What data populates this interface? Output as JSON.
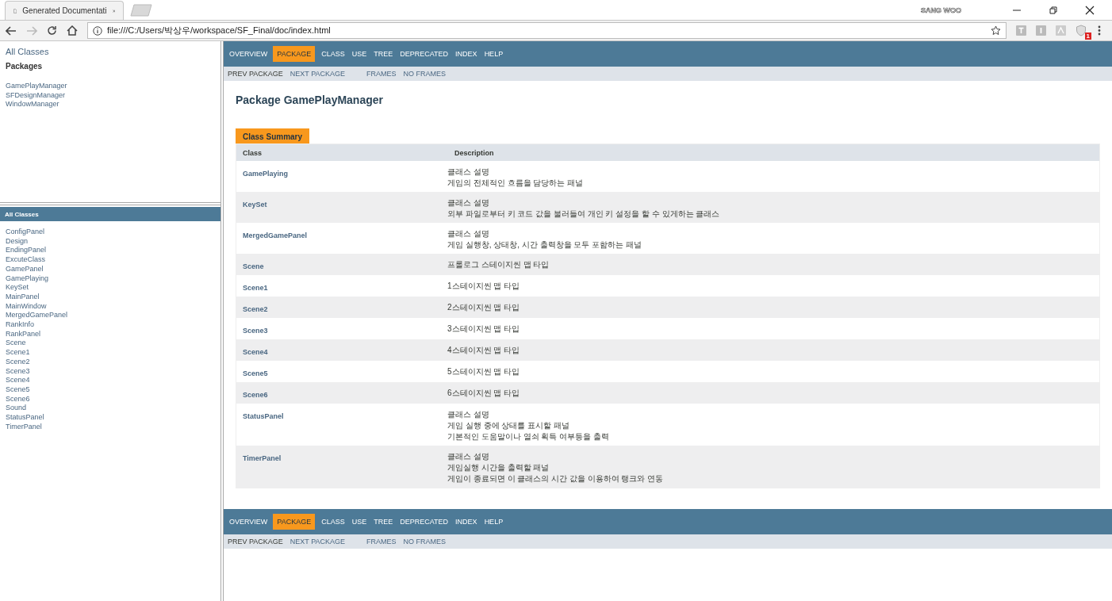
{
  "browser": {
    "tab_title": "Generated Documentati",
    "user": "SANG WOO",
    "url": "file:///C:/Users/박상우/workspace/SF_Final/doc/index.html",
    "extension_badge": "1"
  },
  "packages_frame": {
    "all_classes_link": "All Classes",
    "heading": "Packages",
    "packages": [
      "GamePlayManager",
      "SFDesignManager",
      "WindowManager"
    ]
  },
  "classes_frame": {
    "heading": "All Classes",
    "classes": [
      "ConfigPanel",
      "Design",
      "EndingPanel",
      "ExcuteClass",
      "GamePanel",
      "GamePlaying",
      "KeySet",
      "MainPanel",
      "MainWindow",
      "MergedGamePanel",
      "RankInfo",
      "RankPanel",
      "Scene",
      "Scene1",
      "Scene2",
      "Scene3",
      "Scene4",
      "Scene5",
      "Scene6",
      "Sound",
      "StatusPanel",
      "TimerPanel"
    ]
  },
  "top_nav": {
    "items": [
      {
        "label": "OVERVIEW",
        "selected": false
      },
      {
        "label": "PACKAGE",
        "selected": true
      },
      {
        "label": "CLASS",
        "selected": false
      },
      {
        "label": "USE",
        "selected": false
      },
      {
        "label": "TREE",
        "selected": false
      },
      {
        "label": "DEPRECATED",
        "selected": false
      },
      {
        "label": "INDEX",
        "selected": false
      },
      {
        "label": "HELP",
        "selected": false
      }
    ],
    "package_links": [
      {
        "label": "PREV PACKAGE",
        "disabled": true
      },
      {
        "label": "NEXT PACKAGE",
        "disabled": false
      }
    ],
    "frame_links": [
      {
        "label": "FRAMES",
        "disabled": false
      },
      {
        "label": "NO FRAMES",
        "disabled": false
      }
    ]
  },
  "title": "Package GamePlayManager",
  "summary": {
    "caption": "Class Summary",
    "columns": [
      "Class",
      "Description"
    ],
    "rows": [
      {
        "name": "GamePlaying",
        "description": [
          "클래스 설명",
          "게임의 전체적인 흐름을 담당하는 패널"
        ]
      },
      {
        "name": "KeySet",
        "description": [
          "클래스 설명",
          "외부 파일로부터 키 코드 값을 불러들여 개인 키 설정을 할 수 있게하는 클래스"
        ]
      },
      {
        "name": "MergedGamePanel",
        "description": [
          "클래스 설명",
          "게임 실행창, 상태창, 시간 출력창을 모두 포함하는 패널"
        ]
      },
      {
        "name": "Scene",
        "description": [
          "프롤로그 스테이지씬 맵 타입"
        ]
      },
      {
        "name": "Scene1",
        "description": [
          "1스테이지씬 맵 타입"
        ]
      },
      {
        "name": "Scene2",
        "description": [
          "2스테이지씬 맵 타입"
        ]
      },
      {
        "name": "Scene3",
        "description": [
          "3스테이지씬 맵 타입"
        ]
      },
      {
        "name": "Scene4",
        "description": [
          "4스테이지씬 맵 타입"
        ]
      },
      {
        "name": "Scene5",
        "description": [
          "5스테이지씬 맵 타입"
        ]
      },
      {
        "name": "Scene6",
        "description": [
          "6스테이지씬 맵 타입"
        ]
      },
      {
        "name": "StatusPanel",
        "description": [
          "클래스 설명",
          "게임 실행 중에 상태를 표시할 패널",
          "기본적인 도움말이나 열쇠 획득 여부등을 출력"
        ]
      },
      {
        "name": "TimerPanel",
        "description": [
          "클래스 설명",
          "게임실행 시간을 출력할 패널",
          "게임이 종료되면 이 클래스의 시간 값을 이용하여 랭크와 연동"
        ]
      }
    ]
  },
  "bottom_nav": {
    "items": [
      {
        "label": "OVERVIEW",
        "selected": false
      },
      {
        "label": "PACKAGE",
        "selected": true
      },
      {
        "label": "CLASS",
        "selected": false
      },
      {
        "label": "USE",
        "selected": false
      },
      {
        "label": "TREE",
        "selected": false
      },
      {
        "label": "DEPRECATED",
        "selected": false
      },
      {
        "label": "INDEX",
        "selected": false
      },
      {
        "label": "HELP",
        "selected": false
      }
    ],
    "package_links": [
      {
        "label": "PREV PACKAGE",
        "disabled": true
      },
      {
        "label": "NEXT PACKAGE",
        "disabled": false
      }
    ],
    "frame_links": [
      {
        "label": "FRAMES",
        "disabled": false
      },
      {
        "label": "NO FRAMES",
        "disabled": false
      }
    ]
  }
}
